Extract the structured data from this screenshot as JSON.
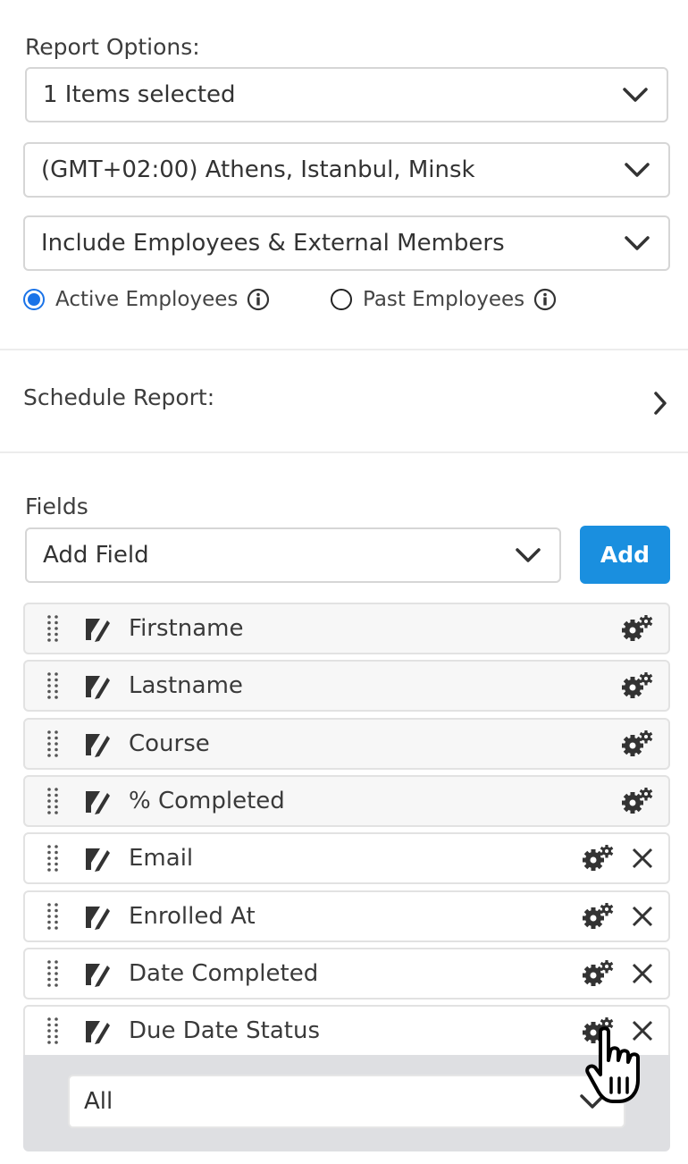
{
  "report_options": {
    "label": "Report Options:",
    "items_select": "1 Items selected",
    "timezone_select": "(GMT+02:00) Athens, Istanbul, Minsk",
    "members_select": "Include Employees & External Members",
    "radio_active": "Active Employees",
    "radio_past": "Past Employees",
    "selected_radio": "active"
  },
  "schedule": {
    "label": "Schedule Report:"
  },
  "fields": {
    "label": "Fields",
    "add_field_placeholder": "Add Field",
    "add_button": "Add",
    "rows": [
      {
        "name": "Firstname",
        "removable": false
      },
      {
        "name": "Lastname",
        "removable": false
      },
      {
        "name": "Course",
        "removable": false
      },
      {
        "name": "% Completed",
        "removable": false
      },
      {
        "name": "Email",
        "removable": true
      },
      {
        "name": "Enrolled At",
        "removable": true
      },
      {
        "name": "Date Completed",
        "removable": true
      },
      {
        "name": "Due Date Status",
        "removable": true
      }
    ],
    "expanded_filter_value": "All"
  },
  "colors": {
    "accent": "#1a8fdf",
    "radio": "#1a73e8",
    "panel": "#dedfe2"
  },
  "icons": {
    "dropdown": "chevron-down-icon",
    "schedule": "chevron-right-icon",
    "info": "info-icon",
    "drag": "drag-handle-icon",
    "edit": "edit-icon",
    "settings": "gears-icon",
    "remove": "close-icon",
    "pointer": "hand-cursor-icon"
  }
}
